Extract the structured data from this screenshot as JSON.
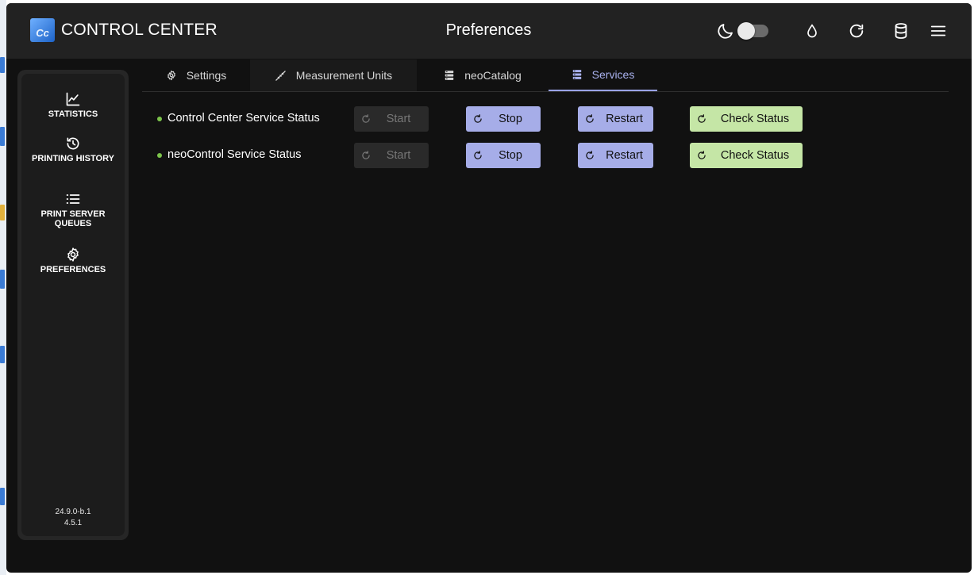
{
  "app": {
    "title": "CONTROL CENTER",
    "logo_text": "Cc"
  },
  "header": {
    "page_title": "Preferences",
    "icons": [
      "moon-icon",
      "theme-toggle",
      "drop-icon",
      "refresh-icon",
      "database-icon",
      "menu-icon"
    ],
    "dark_mode": false
  },
  "sidebar": {
    "items": [
      {
        "label": "STATISTICS",
        "icon": "chart-icon"
      },
      {
        "label": "PRINTING HISTORY",
        "icon": "history-icon"
      },
      {
        "label": "PRINT SERVER QUEUES",
        "icon": "list-icon"
      },
      {
        "label": "PREFERENCES",
        "icon": "gear-icon"
      }
    ],
    "version_line1": "24.9.0-b.1",
    "version_line2": "4.5.1"
  },
  "tabs": [
    {
      "label": "Settings",
      "icon": "gear-icon",
      "active": false
    },
    {
      "label": "Measurement Units",
      "icon": "ruler-icon",
      "active": false
    },
    {
      "label": "neoCatalog",
      "icon": "server-icon",
      "active": false
    },
    {
      "label": "Services",
      "icon": "server-icon",
      "active": true
    }
  ],
  "services": [
    {
      "label": "Control Center Service Status",
      "status_color": "#7cc44b",
      "buttons": {
        "start": "Start",
        "stop": "Stop",
        "restart": "Restart",
        "check": "Check Status"
      },
      "start_disabled": true
    },
    {
      "label": "neoControl Service Status",
      "status_color": "#7cc44b",
      "buttons": {
        "start": "Start",
        "stop": "Stop",
        "restart": "Restart",
        "check": "Check Status"
      },
      "start_disabled": true
    }
  ],
  "colors": {
    "accent": "#a6ade8",
    "active_tab": "#a9b1ee",
    "check_button": "#c5e6a6",
    "status_ok": "#7cc44b"
  }
}
